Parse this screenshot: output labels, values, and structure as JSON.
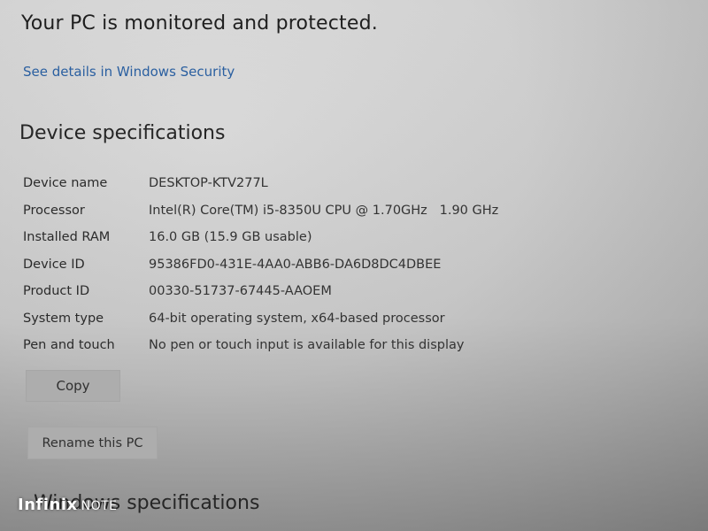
{
  "security": {
    "status_text": "Your PC is monitored and protected.",
    "link_text": "See details in Windows Security"
  },
  "device_specs": {
    "heading": "Device specifications",
    "rows": [
      {
        "label": "Device name",
        "value": "DESKTOP-KTV277L"
      },
      {
        "label": "Processor",
        "value": "Intel(R) Core(TM) i5-8350U CPU @ 1.70GHz   1.90 GHz"
      },
      {
        "label": "Installed RAM",
        "value": "16.0 GB (15.9 GB usable)"
      },
      {
        "label": "Device ID",
        "value": "95386FD0-431E-4AA0-ABB6-DA6D8DC4DBEE"
      },
      {
        "label": "Product ID",
        "value": "00330-51737-67445-AAOEM"
      },
      {
        "label": "System type",
        "value": "64-bit operating system, x64-based processor"
      },
      {
        "label": "Pen and touch",
        "value": "No pen or touch input is available for this display"
      }
    ],
    "copy_button": "Copy",
    "rename_button": "Rename this PC"
  },
  "windows_specs": {
    "heading": "Windows specifications"
  },
  "watermark": {
    "brand": "Infinix",
    "model": "NOTE"
  }
}
